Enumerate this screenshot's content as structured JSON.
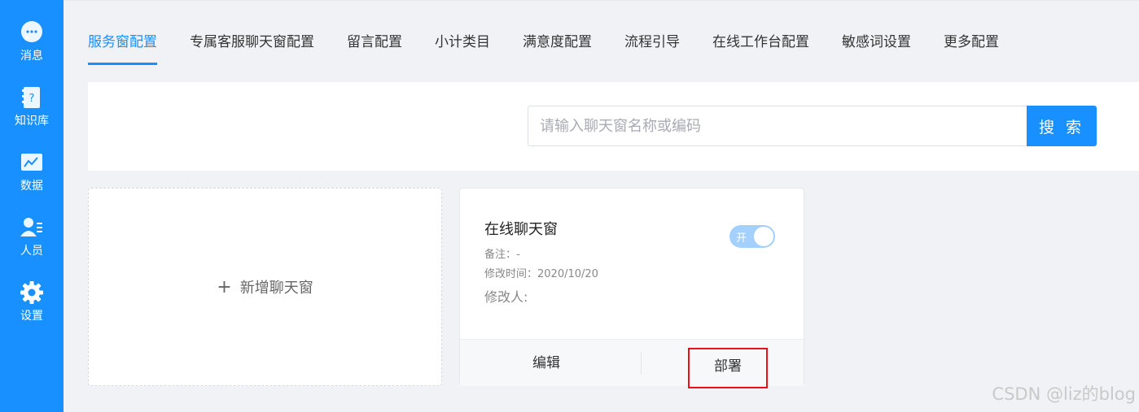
{
  "sidebar": {
    "items": [
      {
        "label": "消息",
        "icon": "chat-bubble-icon"
      },
      {
        "label": "知识库",
        "icon": "question-book-icon"
      },
      {
        "label": "数据",
        "icon": "chart-icon"
      },
      {
        "label": "人员",
        "icon": "user-list-icon"
      },
      {
        "label": "设置",
        "icon": "gear-icon"
      }
    ]
  },
  "tabs": [
    "服务窗配置",
    "专属客服聊天窗配置",
    "留言配置",
    "小计类目",
    "满意度配置",
    "流程引导",
    "在线工作台配置",
    "敏感词设置",
    "更多配置"
  ],
  "active_tab": "服务窗配置",
  "search": {
    "placeholder": "请输入聊天窗名称或编码",
    "value": "",
    "button_label": "搜 索"
  },
  "add_card": {
    "plus": "+",
    "label": "新增聊天窗"
  },
  "chat_card": {
    "title": "在线聊天窗",
    "note": "备注：-",
    "modified_time": "修改时间：2020/10/20",
    "modifier": "修改人:",
    "toggle_label": "开",
    "toggle_on": true,
    "edit_label": "编辑",
    "deploy_label": "部署"
  },
  "watermark": "CSDN @liz的blog",
  "colors": {
    "primary": "#1890ff",
    "highlight_border": "#e5121c",
    "toggle_bg": "#a3d0fd"
  }
}
